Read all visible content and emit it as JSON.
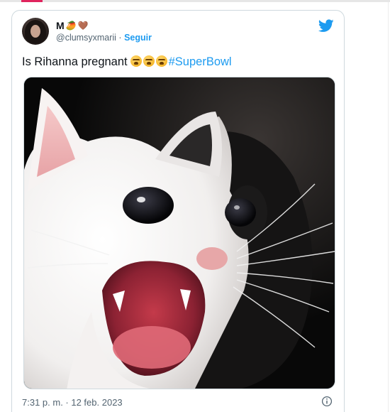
{
  "tweet": {
    "display_name": "M",
    "name_emojis": [
      "🥭",
      "🤎"
    ],
    "handle": "@clumsyxmarii",
    "separator": "·",
    "follow_label": "Seguir",
    "text": "Is Rihanna pregnant",
    "emoji_count": 3,
    "emoji_name": "tired-face",
    "hashtag": "#SuperBowl",
    "timestamp": "7:31 p. m. · 12 feb. 2023"
  },
  "colors": {
    "accent": "#1d9bf0",
    "text": "#0f1419",
    "muted": "#536471",
    "border": "#cfd9de"
  },
  "icons": {
    "logo": "twitter-bird-icon",
    "info": "info-icon"
  },
  "media": {
    "description_icon": "screaming-cat-photo"
  }
}
